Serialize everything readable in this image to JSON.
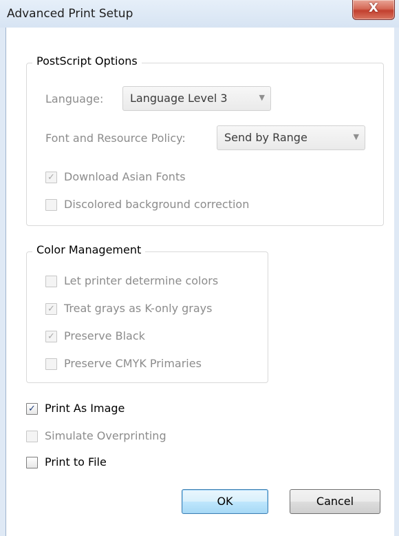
{
  "window": {
    "title": "Advanced Print Setup",
    "close_glyph": "X"
  },
  "postscript": {
    "legend": "PostScript Options",
    "language_label": "Language:",
    "language_value": "Language Level 3",
    "policy_label": "Font and Resource Policy:",
    "policy_value": "Send by Range",
    "download_asian_fonts": {
      "label": "Download Asian Fonts",
      "checked": true,
      "enabled": false
    },
    "discolored_bg": {
      "label": "Discolored background correction",
      "checked": false,
      "enabled": false
    }
  },
  "color_management": {
    "legend": "Color Management",
    "items": [
      {
        "label": "Let printer determine colors",
        "checked": false,
        "enabled": false
      },
      {
        "label": "Treat grays as K-only grays",
        "checked": true,
        "enabled": false
      },
      {
        "label": "Preserve Black",
        "checked": true,
        "enabled": false
      },
      {
        "label": "Preserve CMYK Primaries",
        "checked": false,
        "enabled": false
      }
    ]
  },
  "options": {
    "print_as_image": {
      "label": "Print As Image",
      "checked": true,
      "enabled": true
    },
    "simulate_overprinting": {
      "label": "Simulate Overprinting",
      "checked": false,
      "enabled": false
    },
    "print_to_file": {
      "label": "Print to File",
      "checked": false,
      "enabled": true
    }
  },
  "buttons": {
    "ok": "OK",
    "cancel": "Cancel"
  },
  "icons": {
    "checkmark": "checkmark-icon",
    "dropdown": "chevron-down-icon"
  }
}
